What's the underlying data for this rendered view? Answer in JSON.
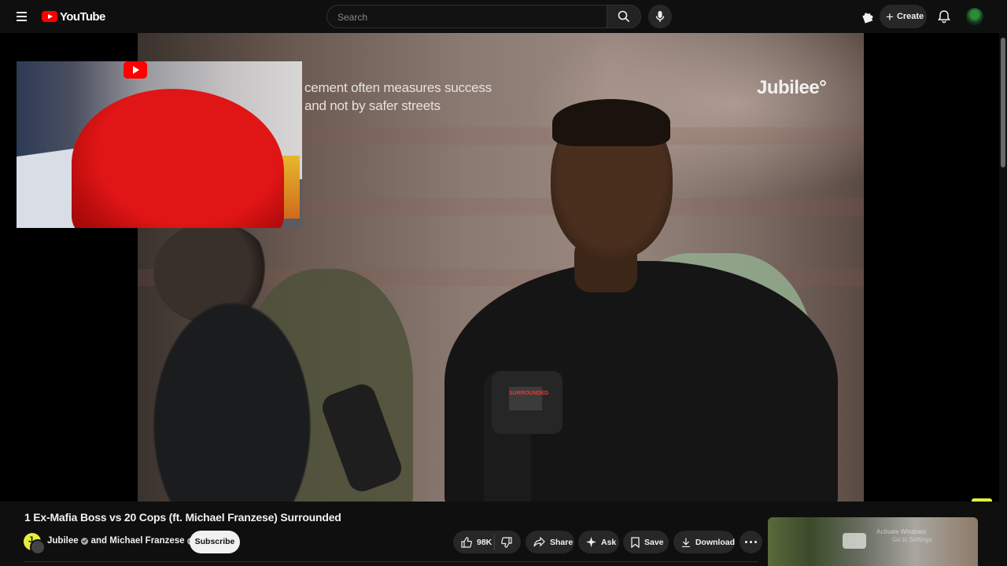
{
  "header": {
    "logo_text": "YouTube",
    "search_placeholder": "Search",
    "create_label": "Create"
  },
  "player": {
    "caption_line1": "cement often measures success",
    "caption_line2": "and not by safer streets",
    "watermark": "Jubilee",
    "mic_flag_text": "SURROUNDED",
    "channel_badge": "J'",
    "rec_overlay_text1": "Activate Windows",
    "rec_overlay_text2": "Go to Settings"
  },
  "video": {
    "title": "1 Ex-Mafia Boss vs 20 Cops (ft. Michael Franzese) Surrounded",
    "channel_name": "Jubilee",
    "channel_joiner": "and",
    "collaborator": "Michael Franzese",
    "subscribe_label": "Subscribe"
  },
  "actions": {
    "like_count": "98K",
    "share_label": "Share",
    "ask_label": "Ask",
    "save_label": "Save",
    "download_label": "Download"
  },
  "colors": {
    "background": "#0f0f0f",
    "brand_red": "#ff0000",
    "jubilee_yellow": "#e5ef3b",
    "pill_bg": "#272727"
  }
}
